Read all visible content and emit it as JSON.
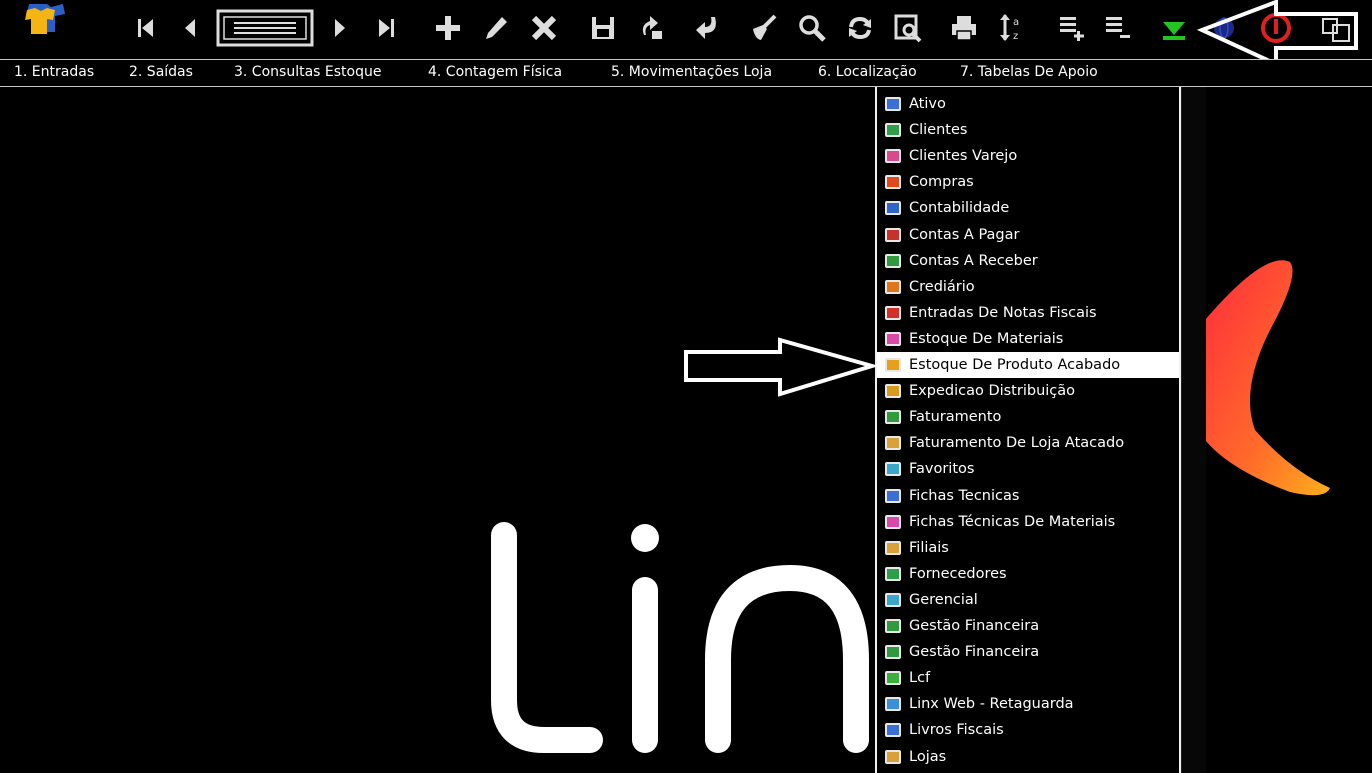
{
  "toolbar": {
    "buttons": [
      {
        "name": "app-logo-icon"
      },
      {
        "name": "first-record-icon"
      },
      {
        "name": "previous-record-icon"
      },
      {
        "name": "record-list-icon"
      },
      {
        "name": "next-record-icon"
      },
      {
        "name": "last-record-icon"
      },
      {
        "name": "add-icon"
      },
      {
        "name": "edit-icon"
      },
      {
        "name": "delete-icon"
      },
      {
        "name": "save-icon"
      },
      {
        "name": "refresh-icon"
      },
      {
        "name": "undo-icon"
      },
      {
        "name": "clear-icon"
      },
      {
        "name": "search-icon"
      },
      {
        "name": "sync-icon"
      },
      {
        "name": "preview-icon"
      },
      {
        "name": "print-icon"
      },
      {
        "name": "sort-az-icon"
      },
      {
        "name": "add-line-icon"
      },
      {
        "name": "remove-line-icon"
      },
      {
        "name": "download-icon"
      },
      {
        "name": "globe-icon"
      },
      {
        "name": "power-icon"
      },
      {
        "name": "windows-icon"
      }
    ]
  },
  "menubar": {
    "items": [
      "1. Entradas",
      "2. Saídas",
      "3. Consultas Estoque",
      "4. Contagem Física",
      "5. Movimentações Loja",
      "6. Localização",
      "7. Tabelas De Apoio"
    ]
  },
  "dropdown": {
    "selected_index": 10,
    "items": [
      {
        "label": "Ativo",
        "icon": "ativo-icon",
        "color": "#3b6fd6"
      },
      {
        "label": "Clientes",
        "icon": "clientes-icon",
        "color": "#2e9e4a"
      },
      {
        "label": "Clientes Varejo",
        "icon": "clientes-varejo-icon",
        "color": "#d94a8c"
      },
      {
        "label": "Compras",
        "icon": "compras-icon",
        "color": "#e04a1c"
      },
      {
        "label": "Contabilidade",
        "icon": "contabilidade-icon",
        "color": "#2f65c9"
      },
      {
        "label": "Contas A Pagar",
        "icon": "contas-a-pagar-icon",
        "color": "#c8302a"
      },
      {
        "label": "Contas A Receber",
        "icon": "contas-a-receber-icon",
        "color": "#2f9a3e"
      },
      {
        "label": "Crediário",
        "icon": "crediario-icon",
        "color": "#e0761c"
      },
      {
        "label": "Entradas De Notas Fiscais",
        "icon": "entradas-notas-icon",
        "color": "#d4302a"
      },
      {
        "label": "Estoque De Materiais",
        "icon": "estoque-materiais-icon",
        "color": "#d94aa8"
      },
      {
        "label": "Estoque De Produto Acabado",
        "icon": "estoque-produto-icon",
        "color": "#e8a01c"
      },
      {
        "label": "Expedicao Distribuição",
        "icon": "expedicao-icon",
        "color": "#d79a1c"
      },
      {
        "label": "Faturamento",
        "icon": "faturamento-icon",
        "color": "#2f9a3e"
      },
      {
        "label": "Faturamento De Loja Atacado",
        "icon": "faturamento-atacado-icon",
        "color": "#d8a23a"
      },
      {
        "label": "Favoritos",
        "icon": "favoritos-icon",
        "color": "#3aa6c9"
      },
      {
        "label": "Fichas Tecnicas",
        "icon": "fichas-tecnicas-icon",
        "color": "#3b6fd6"
      },
      {
        "label": "Fichas Técnicas De Materiais",
        "icon": "fichas-materiais-icon",
        "color": "#d94aa8"
      },
      {
        "label": "Filiais",
        "icon": "filiais-icon",
        "color": "#d8a23a"
      },
      {
        "label": "Fornecedores",
        "icon": "fornecedores-icon",
        "color": "#2e9e4a"
      },
      {
        "label": "Gerencial",
        "icon": "gerencial-icon",
        "color": "#3aa6c9"
      },
      {
        "label": "Gestão Financeira",
        "icon": "gestao-financeira-icon",
        "color": "#2f9a3e"
      },
      {
        "label": "Gestão Financeira",
        "icon": "gestao-financeira-2-icon",
        "color": "#2f9a3e"
      },
      {
        "label": "Lcf",
        "icon": "lcf-icon",
        "color": "#3cae3c"
      },
      {
        "label": "Linx Web - Retaguarda",
        "icon": "linx-web-icon",
        "color": "#3b8fd6"
      },
      {
        "label": "Livros Fiscais",
        "icon": "livros-fiscais-icon",
        "color": "#3b6fd6"
      },
      {
        "label": "Lojas",
        "icon": "lojas-icon",
        "color": "#d8a23a"
      }
    ]
  },
  "colors": {
    "background": "#000000",
    "logo_gradient_start": "#ff3c3c",
    "logo_gradient_end": "#ffa024",
    "download_green": "#22c322",
    "power_red": "#e02020"
  }
}
